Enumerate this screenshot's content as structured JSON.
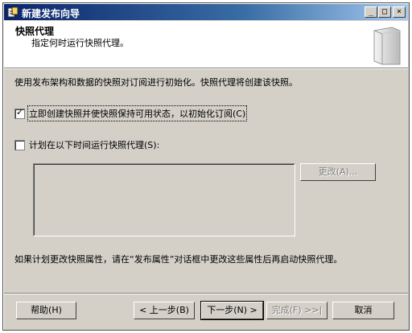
{
  "window": {
    "title": "新建发布向导",
    "controls": {
      "minimize": "_",
      "maximize": "□",
      "close": "×"
    }
  },
  "header": {
    "title": "快照代理",
    "subtitle": "指定何时运行快照代理。",
    "illustration_icon": "book-binder-icon"
  },
  "body": {
    "intro": "使用发布架构和数据的快照对订阅进行初始化。快照代理将创建该快照。",
    "option_immediate": {
      "label": "立即创建快照并使快照保持可用状态，以初始化订阅(C)",
      "checked": true
    },
    "option_schedule": {
      "label": "计划在以下时间运行快照代理(S):",
      "checked": false
    },
    "change_button": "更改(A)...",
    "note": "如果计划更改快照属性，请在“发布属性”对话框中更改这些属性后再启动快照代理。"
  },
  "footer": {
    "help": "帮助(H)",
    "back": "< 上一步(B)",
    "next": "下一步(N) >",
    "finish": "完成(F) >>|",
    "cancel": "取消"
  },
  "colors": {
    "dialog_bg": "#d4d0c8",
    "title_start": "#0a246a",
    "title_end": "#a6caf0"
  }
}
